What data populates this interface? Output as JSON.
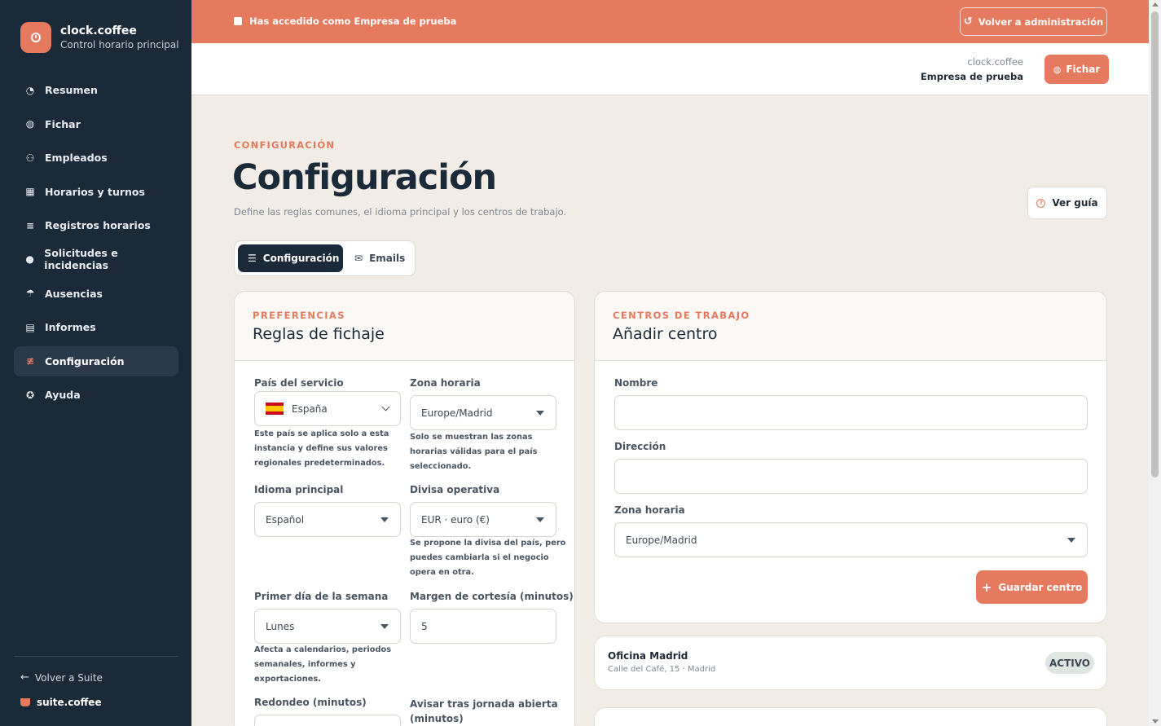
{
  "brand": {
    "name": "clock.coffee",
    "subtitle": "Control horario principal"
  },
  "sidebar": {
    "items": [
      {
        "label": "Resumen",
        "icon": "pie-chart-icon",
        "glyph": "◔"
      },
      {
        "label": "Fichar",
        "icon": "fingerprint-icon",
        "glyph": "◍"
      },
      {
        "label": "Empleados",
        "icon": "users-icon",
        "glyph": "⚇"
      },
      {
        "label": "Horarios y turnos",
        "icon": "calendar-icon",
        "glyph": "▦"
      },
      {
        "label": "Registros horarios",
        "icon": "list-icon",
        "glyph": "≡"
      },
      {
        "label": "Solicitudes e incidencias",
        "icon": "alert-circle-icon",
        "glyph": "●"
      },
      {
        "label": "Ausencias",
        "icon": "umbrella-icon",
        "glyph": "☂"
      },
      {
        "label": "Informes",
        "icon": "chart-icon",
        "glyph": "▤"
      },
      {
        "label": "Configuración",
        "icon": "sliders-icon",
        "glyph": "≢",
        "active": true
      },
      {
        "label": "Ayuda",
        "icon": "help-circle-icon",
        "glyph": "✪"
      }
    ],
    "back_label": "Volver a Suite",
    "suite_label": "suite.coffee"
  },
  "banner": {
    "text": "Has accedido como Empresa de prueba",
    "back_button": "Volver a administración"
  },
  "header": {
    "app_name": "clock.coffee",
    "company": "Empresa de prueba",
    "fichar_button": "Fichar"
  },
  "page": {
    "eyebrow": "CONFIGURACIÓN",
    "title": "Configuración",
    "description": "Define las reglas comunes, el idioma principal y los centros de trabajo.",
    "guide_button": "Ver guía"
  },
  "tabs": [
    {
      "label": "Configuración",
      "active": true
    },
    {
      "label": "Emails",
      "active": false
    }
  ],
  "preferences": {
    "eyebrow": "PREFERENCIAS",
    "title": "Reglas de fichaje",
    "country": {
      "label": "País del servicio",
      "value": "España",
      "help": [
        "Este país se aplica solo a esta",
        "instancia y define sus valores",
        "regionales predeterminados."
      ]
    },
    "timezone": {
      "label": "Zona horaria",
      "value": "Europe/Madrid",
      "help": [
        "Solo se muestran las zonas",
        "horarias válidas para el país",
        "seleccionado."
      ]
    },
    "language": {
      "label": "Idioma principal",
      "value": "Español"
    },
    "currency": {
      "label": "Divisa operativa",
      "value": "EUR · euro (€)",
      "help": [
        "Se propone la divisa del país, pero",
        "puedes cambiarla si el negocio",
        "opera en otra."
      ]
    },
    "week_start": {
      "label": "Primer día de la semana",
      "value": "Lunes",
      "help": [
        "Afecta a calendarios, periodos",
        "semanales, informes y",
        "exportaciones."
      ]
    },
    "grace": {
      "label": "Margen de cortesía (minutos)",
      "value": "5"
    },
    "rounding": {
      "label": "Redondeo (minutos)"
    },
    "open_shift": {
      "label_line1": "Avisar tras jornada abierta",
      "label_line2": "(minutos)"
    }
  },
  "centers": {
    "eyebrow": "CENTROS DE TRABAJO",
    "title": "Añadir centro",
    "name_label": "Nombre",
    "name_value": "",
    "address_label": "Dirección",
    "address_value": "",
    "timezone_label": "Zona horaria",
    "timezone_value": "Europe/Madrid",
    "save_button": "Guardar centro",
    "list": [
      {
        "name": "Oficina Madrid",
        "address": "Calle del Café, 15 · Madrid",
        "status": "ACTIVO"
      }
    ]
  },
  "colors": {
    "accent": "#e67a5e",
    "sidebar": "#1b2a38",
    "background": "#f1ece5"
  }
}
